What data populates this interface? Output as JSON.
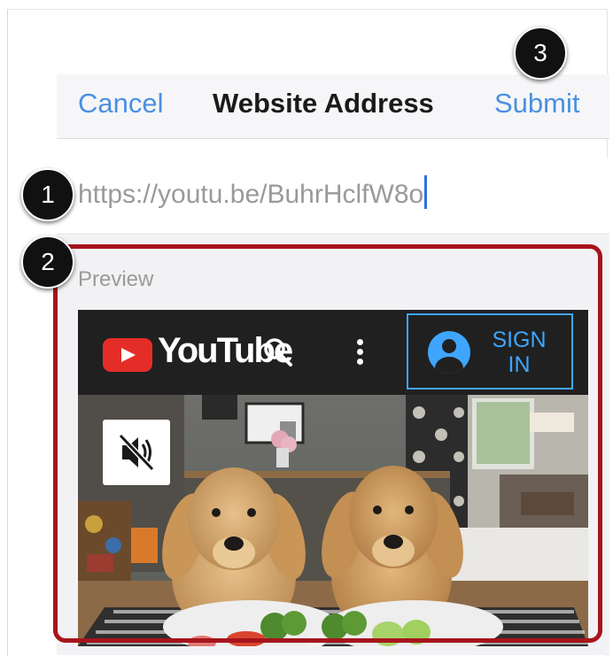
{
  "navbar": {
    "cancel_label": "Cancel",
    "title": "Website Address",
    "submit_label": "Submit",
    "accent_color": "#4a90e2"
  },
  "url_field": {
    "value": "https://youtu.be/BuhrHclfW8o"
  },
  "preview": {
    "label": "Preview",
    "youtube_header": {
      "logo_icon": "youtube-play-icon",
      "wordmark": "YouTube",
      "search_icon": "search-icon",
      "more_icon": "more-vertical-icon",
      "sign_in_label_line1": "SIGN",
      "sign_in_label_line2": "IN",
      "sign_in_color": "#3ea6ff"
    },
    "video": {
      "mute_icon": "speaker-muted-icon"
    }
  },
  "annotations": {
    "step_1": "1",
    "step_2": "2",
    "step_3": "3",
    "highlight_color": "#a7141c"
  }
}
